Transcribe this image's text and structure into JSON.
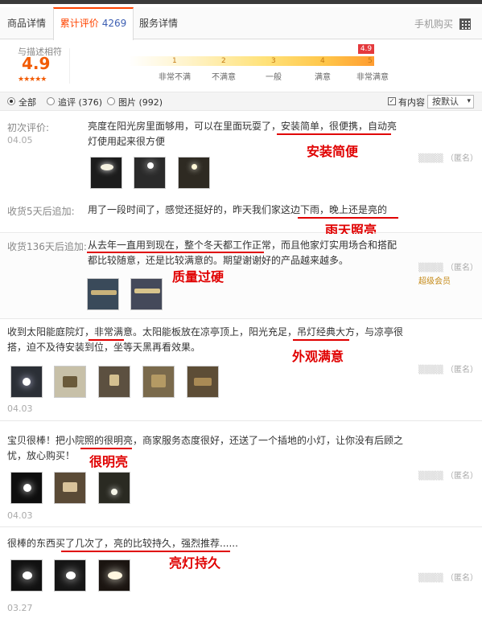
{
  "tabs": {
    "product_details": "商品详情",
    "reviews_label": "累计评价",
    "reviews_count": "4269",
    "service_details": "服务详情",
    "mobile_buy": "手机购买"
  },
  "score": {
    "caption": "与描述相符",
    "value": "4.9",
    "stars": "★★★★★",
    "badge": "4.9",
    "scale": [
      "1",
      "2",
      "3",
      "4",
      "5"
    ],
    "scale_labels": [
      "非常不满",
      "不满意",
      "一般",
      "满意",
      "非常满意"
    ]
  },
  "filters": {
    "all": "全部",
    "followups": "追评 (376)",
    "images": "图片 (992)",
    "has_content": "有内容",
    "sort": "按默认"
  },
  "reviews": [
    {
      "initial_label": "初次评价:",
      "initial_date": "04.05",
      "text_1": "亮度在阳光房里面够用，可以在里面玩耍了，安装简单，很便携，自动亮",
      "text_2": "灯使用起来很方便",
      "annotation": "安装简便",
      "followup_label": "收货5天后追加:",
      "followup_text": "用了一段时间了，感觉还挺好的，昨天我们家这边下雨，晚上还是亮的",
      "followup_annotation": "雨天照亮",
      "user": "（匿名）"
    },
    {
      "followup_label": "收货136天后追加:",
      "text_1": "从去年一直用到现在，整个冬天都工作正常，而且他家灯实用场合和搭配",
      "text_2": "都比较随意，还是比较满意的。期望谢谢好的产品越来越多。",
      "annotation": "质量过硬",
      "user": "（匿名）",
      "badge": "超级会员"
    },
    {
      "text_1": "收到太阳能庭院灯，非常满意。太阳能板放在凉亭顶上，阳光充足，吊灯经典大方，与凉亭很",
      "text_2": "搭，迫不及待安装到位，坐等天黑再看效果。",
      "annotation": "外观满意",
      "date": "04.03",
      "user": "（匿名）"
    },
    {
      "text_1": "宝贝很棒！把小院照的很明亮，商家服务态度很好，还送了一个插地的小灯，让你没有后顾之",
      "text_2": "忧，放心购买！",
      "annotation": "很明亮",
      "date": "04.03",
      "user": "（匿名）"
    },
    {
      "text_1": "很棒的东西买了几次了，亮的比较持久，强烈推荐......",
      "annotation": "亮灯持久",
      "date": "03.27",
      "user": "（匿名）"
    }
  ],
  "colors": {
    "accent": "#ff4400",
    "annotation": "#e00000",
    "link_blue": "#3d5fb3",
    "score": "#f25b05"
  }
}
